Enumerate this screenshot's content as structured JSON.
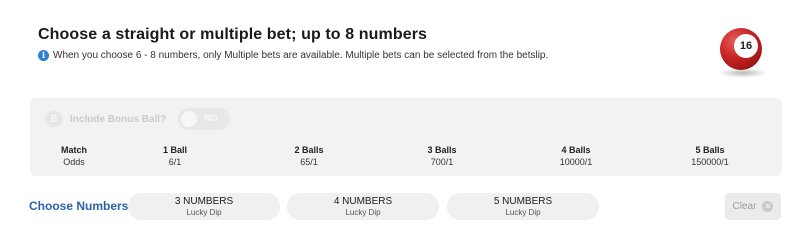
{
  "header": {
    "title": "Choose a straight or multiple bet; up to 8 numbers",
    "info_icon": "info-icon",
    "info_text": "When you choose 6 - 8 numbers, only Multiple bets are available. Multiple bets can be selected from the betslip."
  },
  "ball": {
    "number": "16",
    "color": "#c62222"
  },
  "bonus": {
    "icon_letter": "B",
    "label": "Include Bonus Ball?",
    "toggle_text": "NO",
    "enabled": false
  },
  "odds_table": {
    "columns": [
      {
        "header": "Match",
        "value": "Odds"
      },
      {
        "header": "1 Ball",
        "value": "6/1"
      },
      {
        "header": "2 Balls",
        "value": "65/1"
      },
      {
        "header": "3 Balls",
        "value": "700/1"
      },
      {
        "header": "4 Balls",
        "value": "10000/1"
      },
      {
        "header": "5 Balls",
        "value": "150000/1"
      }
    ]
  },
  "choose_numbers": {
    "label": "Choose Numbers",
    "lucky_dips": [
      {
        "title": "3 NUMBERS",
        "subtitle": "Lucky Dip"
      },
      {
        "title": "4 NUMBERS",
        "subtitle": "Lucky Dip"
      },
      {
        "title": "5 NUMBERS",
        "subtitle": "Lucky Dip"
      }
    ],
    "clear_label": "Clear",
    "clear_icon": "close-icon"
  },
  "colors": {
    "accent": "#2b63a8",
    "info": "#2e7fd3",
    "panel": "#f2f2f2"
  }
}
